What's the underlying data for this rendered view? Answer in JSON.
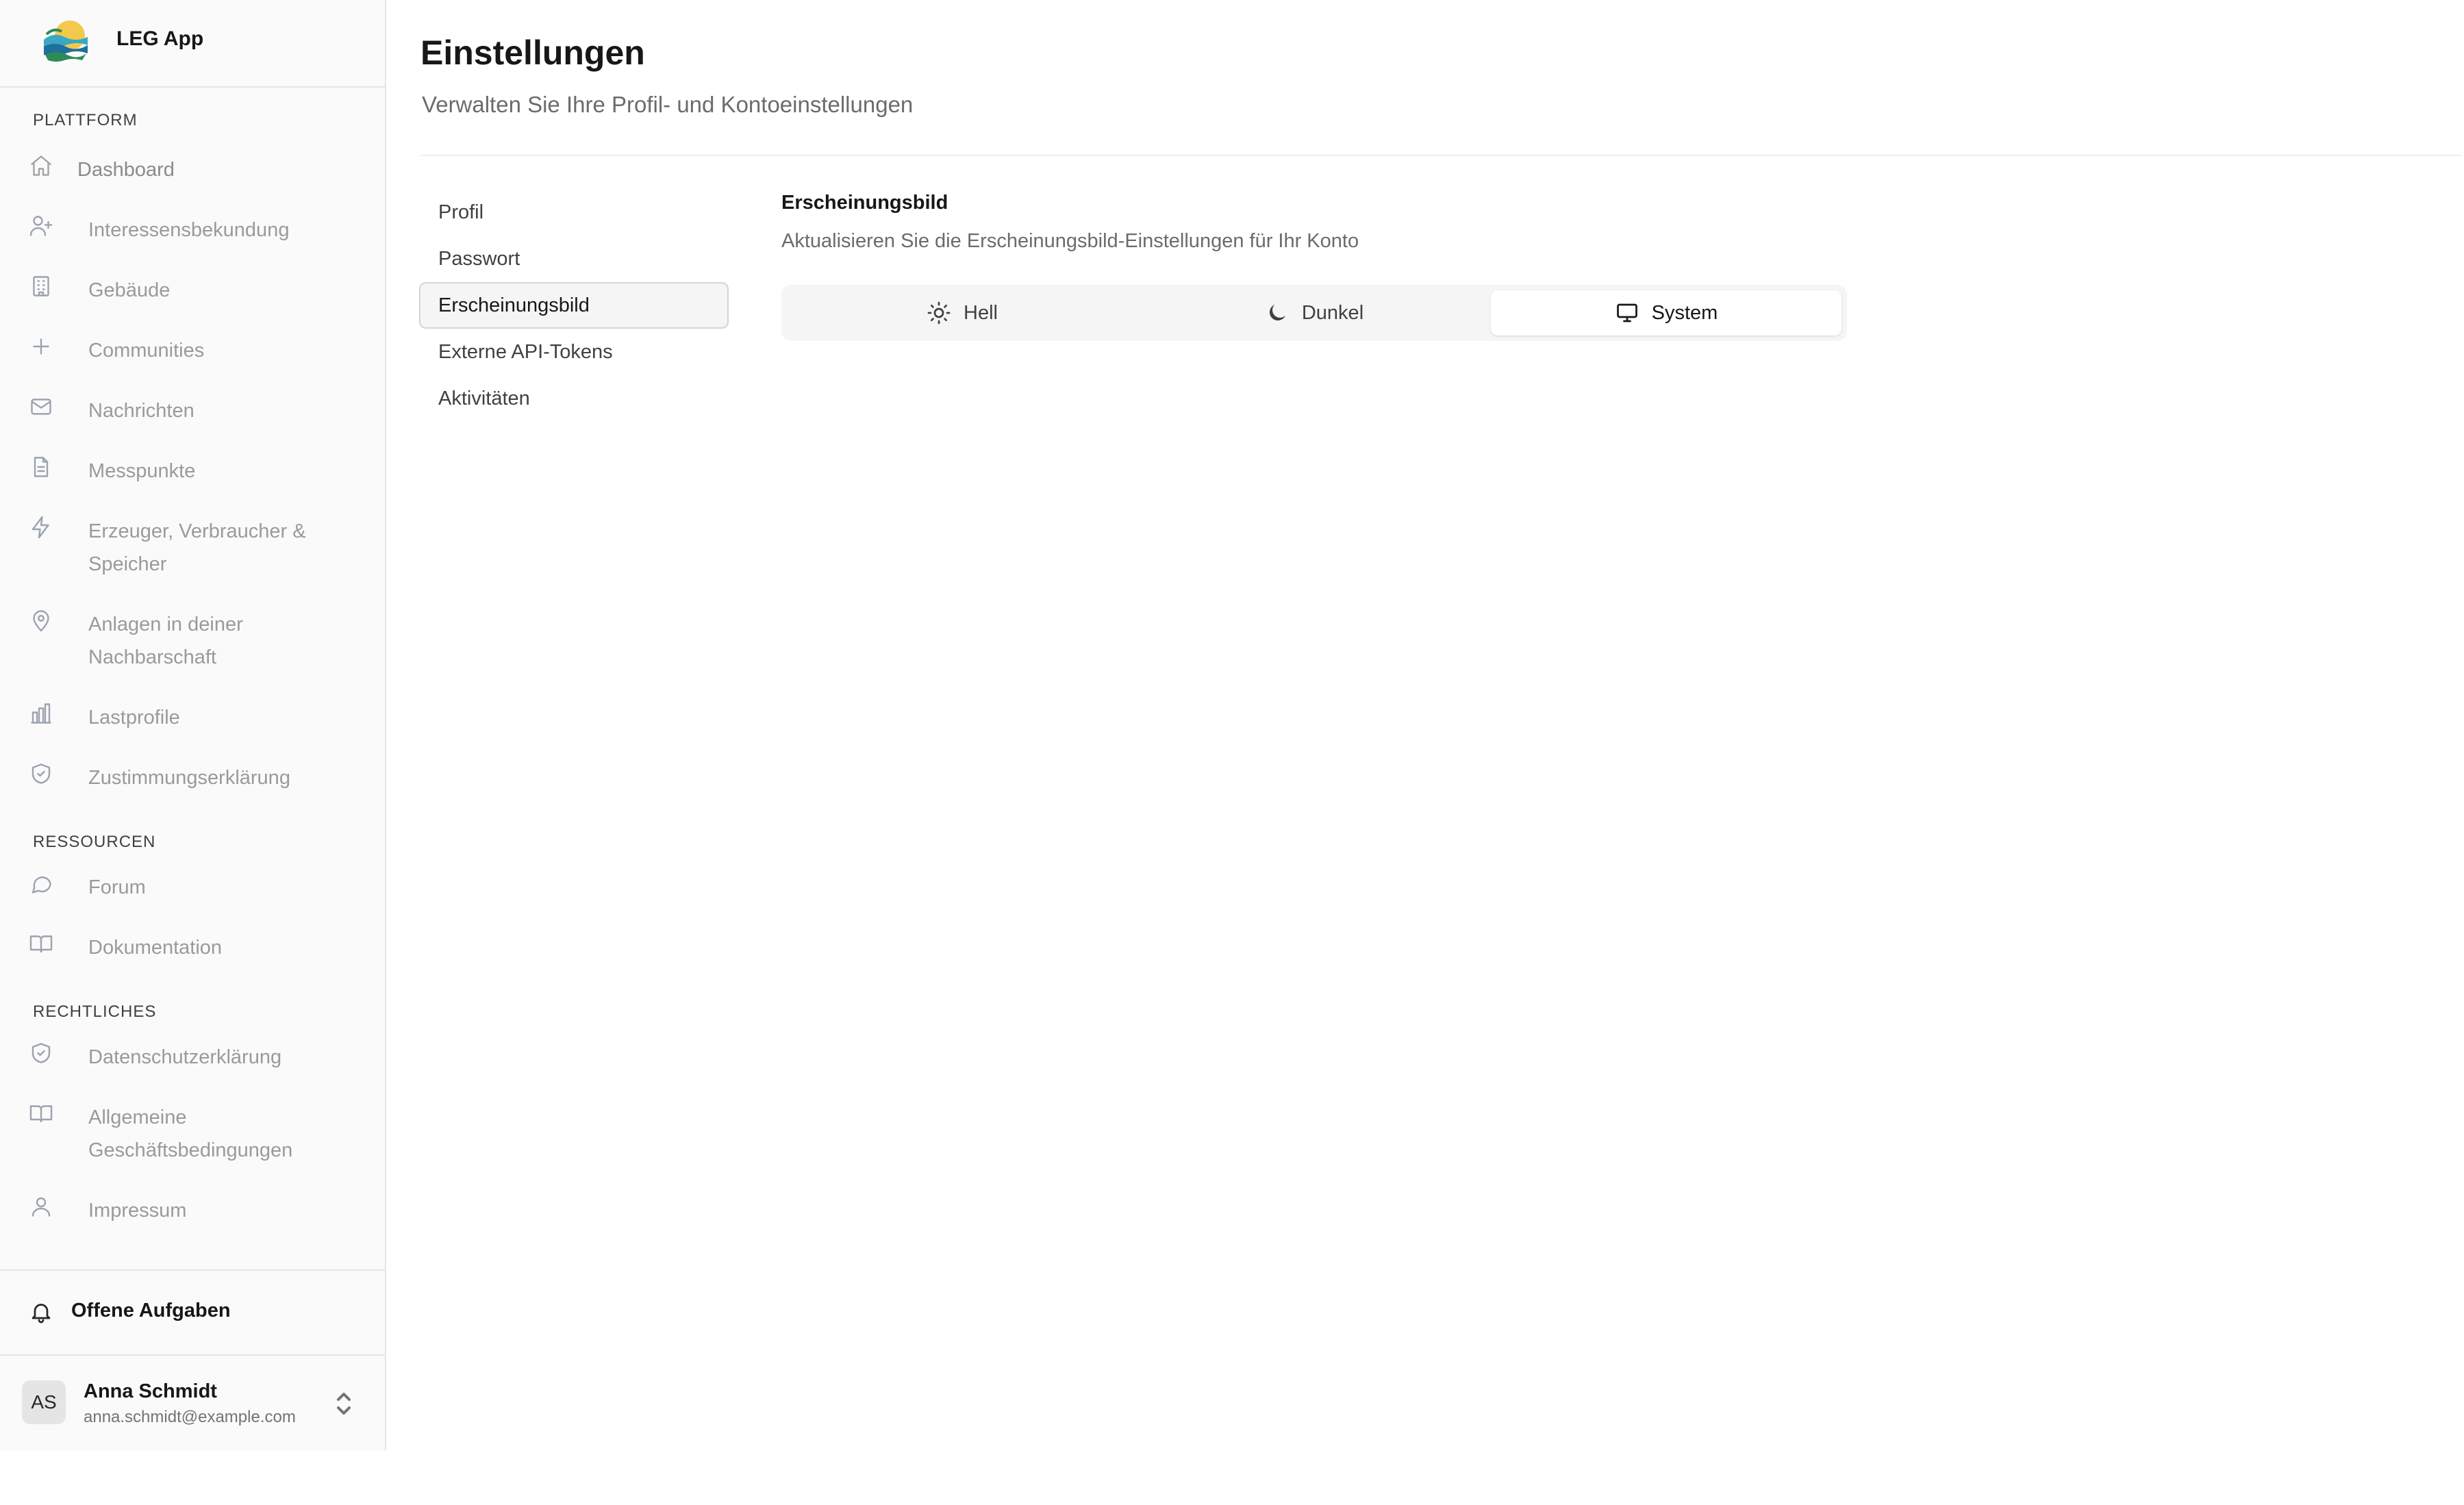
{
  "app": {
    "name": "LEG App"
  },
  "sidebar": {
    "sections": [
      {
        "label": "PLATTFORM"
      },
      {
        "label": "RESSOURCEN"
      },
      {
        "label": "RECHTLICHES"
      }
    ],
    "platform_items": [
      {
        "label": "Dashboard",
        "icon": "home-icon"
      },
      {
        "label": "Interessensbekundung",
        "icon": "user-plus-icon"
      },
      {
        "label": "Gebäude",
        "icon": "building-icon"
      },
      {
        "label": "Communities",
        "icon": "plus-icon"
      },
      {
        "label": "Nachrichten",
        "icon": "mail-icon"
      },
      {
        "label": "Messpunkte",
        "icon": "document-icon"
      },
      {
        "label": "Erzeuger, Verbraucher & Speicher",
        "icon": "lightning-icon"
      },
      {
        "label": "Anlagen in deiner Nachbarschaft",
        "icon": "map-pin-icon"
      },
      {
        "label": "Lastprofile",
        "icon": "bar-chart-icon"
      },
      {
        "label": "Zustimmungserklärung",
        "icon": "shield-check-icon"
      }
    ],
    "resource_items": [
      {
        "label": "Forum",
        "icon": "chat-bubble-icon"
      },
      {
        "label": "Dokumentation",
        "icon": "book-open-icon"
      }
    ],
    "legal_items": [
      {
        "label": "Datenschutzerklärung",
        "icon": "shield-check-icon"
      },
      {
        "label": "Allgemeine Geschäftsbedingungen",
        "icon": "book-open-icon"
      },
      {
        "label": "Impressum",
        "icon": "user-icon"
      }
    ],
    "tasks": {
      "label": "Offene Aufgaben",
      "icon": "bell-icon"
    },
    "user": {
      "initials": "AS",
      "name": "Anna Schmidt",
      "email": "anna.schmidt@example.com"
    }
  },
  "page": {
    "title": "Einstellungen",
    "subtitle": "Verwalten Sie Ihre Profil- und Kontoeinstellungen"
  },
  "settings_nav": [
    {
      "label": "Profil"
    },
    {
      "label": "Passwort"
    },
    {
      "label": "Erscheinungsbild",
      "active": true
    },
    {
      "label": "Externe API-Tokens"
    },
    {
      "label": "Aktivitäten"
    }
  ],
  "appearance": {
    "title": "Erscheinungsbild",
    "description": "Aktualisieren Sie die Erscheinungsbild-Einstellungen für Ihr Konto",
    "options": [
      {
        "label": "Hell",
        "icon": "sun-icon"
      },
      {
        "label": "Dunkel",
        "icon": "moon-icon"
      },
      {
        "label": "System",
        "icon": "monitor-icon",
        "selected": true
      }
    ]
  }
}
